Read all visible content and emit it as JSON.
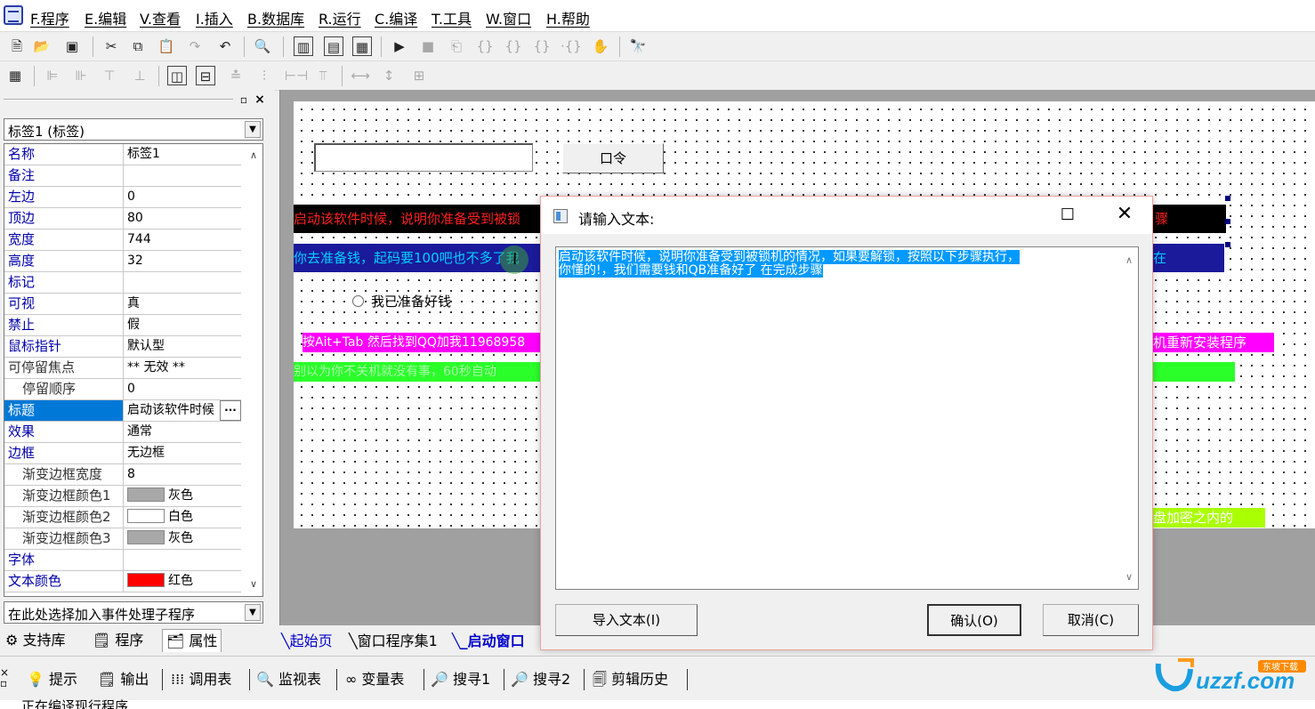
{
  "menu": {
    "items": [
      "F.程序",
      "E.编辑",
      "V.查看",
      "I.插入",
      "B.数据库",
      "R.运行",
      "C.编译",
      "T.工具",
      "W.窗口",
      "H.帮助"
    ]
  },
  "toolbar": {
    "main_icons": [
      "new-file-icon",
      "open-folder-icon",
      "save-icon",
      "cut-icon",
      "copy-icon",
      "paste-icon",
      "redo-icon",
      "undo-icon",
      "find-icon",
      "layout1-icon",
      "layout2-icon",
      "layout3-icon",
      "run-icon",
      "stop-icon",
      "step-icon",
      "step-into-icon",
      "step-over-icon",
      "step-out-icon",
      "breakpoint-icon",
      "hand-icon",
      "search-binoculars-icon"
    ],
    "align_icons": [
      "calculator-icon",
      "align-left-icon",
      "align-center-icon",
      "align-right-icon",
      "align-top-icon",
      "center-h-icon",
      "center-v-icon",
      "align-middle-icon",
      "align-bottom-icon",
      "space-h-icon",
      "space-v-icon",
      "same-width-icon",
      "same-height-icon",
      "same-size-icon"
    ]
  },
  "left_panel": {
    "object_selector": "标签1 (标签)",
    "properties": [
      {
        "name": "名称",
        "value": "标签1"
      },
      {
        "name": "备注",
        "value": ""
      },
      {
        "name": "左边",
        "value": "0"
      },
      {
        "name": "顶边",
        "value": "80"
      },
      {
        "name": "宽度",
        "value": "744"
      },
      {
        "name": "高度",
        "value": "32"
      },
      {
        "name": "标记",
        "value": ""
      },
      {
        "name": "可视",
        "value": "真"
      },
      {
        "name": "禁止",
        "value": "假"
      },
      {
        "name": "鼠标指针",
        "value": "默认型"
      },
      {
        "name": "可停留焦点",
        "value": "** 无效 **"
      },
      {
        "name": "停留顺序",
        "value": "0"
      },
      {
        "name": "标题",
        "value": "启动该软件时候"
      },
      {
        "name": "效果",
        "value": "通常"
      },
      {
        "name": "边框",
        "value": "无边框"
      },
      {
        "name": "渐变边框宽度",
        "value": "8"
      },
      {
        "name": "渐变边框颜色1",
        "value": "灰色"
      },
      {
        "name": "渐变边框颜色2",
        "value": "白色"
      },
      {
        "name": "渐变边框颜色3",
        "value": "灰色"
      },
      {
        "name": "字体",
        "value": ""
      },
      {
        "name": "文本颜色",
        "value": "红色"
      }
    ],
    "event_selector": "在此处选择加入事件处理子程序",
    "tabs": [
      "支持库",
      "程序",
      "属性"
    ]
  },
  "colors": {
    "gray": "#a8a8a8",
    "white": "#ffffff",
    "red": "#ff0000",
    "selection": "#0078d7"
  },
  "design": {
    "button_label": "口令",
    "label_red": "启动该软件时候，说明你准备受到被锁",
    "label_red_tail": "骤",
    "label_blue": "你去准备钱，起码要100吧也不多了我",
    "label_blue_tail": "在",
    "radio_label": "我已准备好钱",
    "label_magenta": "按Ait+Tab 然后找到QQ加我11968958",
    "label_magenta_tail": "机重新安装程序",
    "label_green": "别以为你不关机就没有事，60秒自动",
    "label_lime_tail": "盘加密之内的"
  },
  "bottom_tabs": [
    "起始页",
    "窗口程序集1",
    "_启动窗口"
  ],
  "dialog": {
    "title": "请输入文本:",
    "text_line1": "启动该软件时候，说明你准备受到被锁机的情况，如果要解锁，按照以下步骤执行，",
    "text_line2": "你懂的!，我们需要钱和QB准备好了 在完成步骤",
    "import_label": "导入文本(I)",
    "ok_label": "确认(O)",
    "cancel_label": "取消(C)"
  },
  "bottom_bar": {
    "items": [
      "提示",
      "输出",
      "调用表",
      "监视表",
      "变量表",
      "搜寻1",
      "搜寻2",
      "剪辑历史"
    ]
  },
  "status": {
    "text": "正在编译现行程序"
  },
  "watermark": {
    "text": "uzzf.com",
    "subtext": "东坡下载"
  }
}
